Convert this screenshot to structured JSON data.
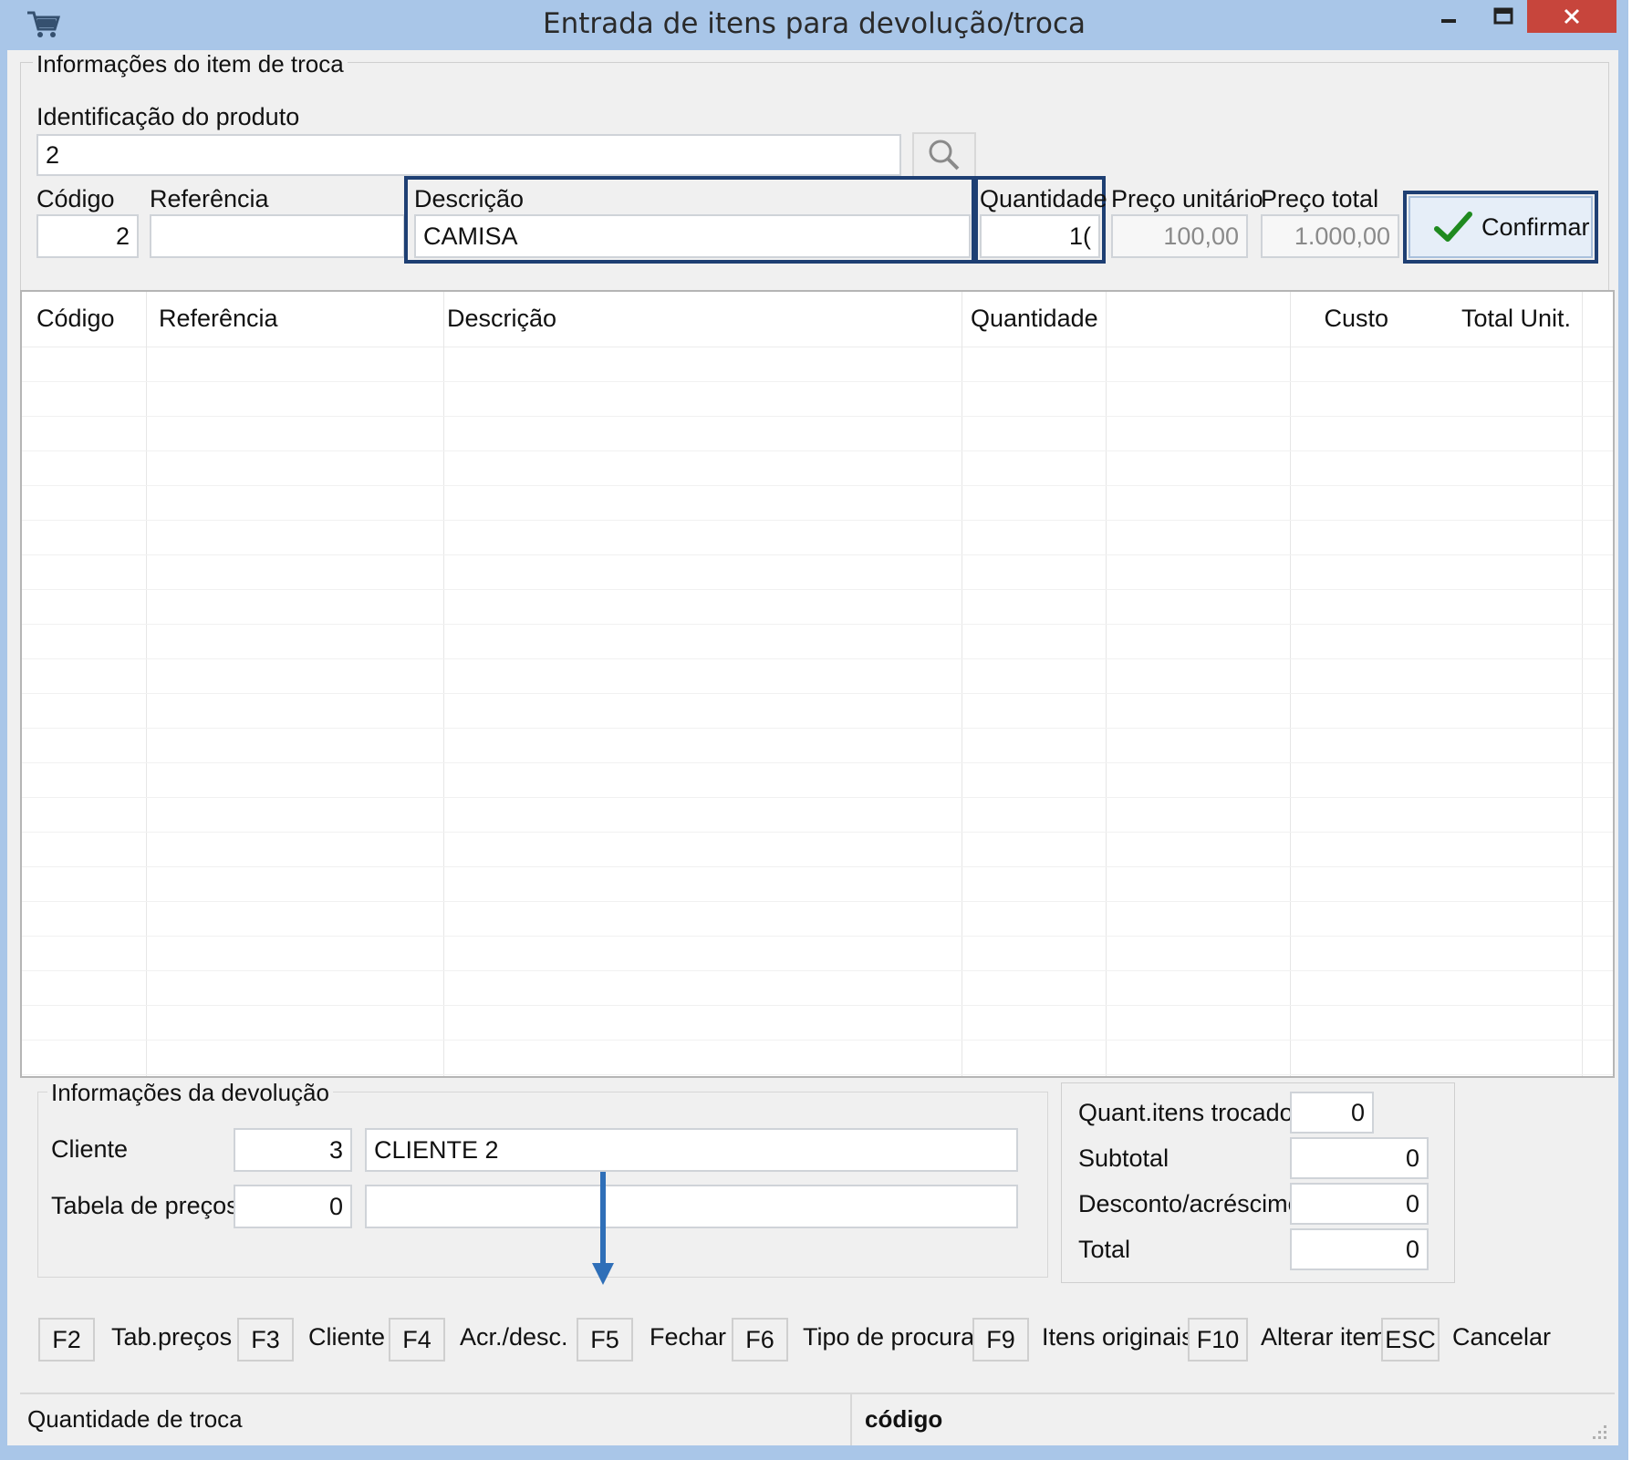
{
  "window": {
    "title": "Entrada de itens para devolução/troca",
    "icon": "cart-icon"
  },
  "item_group": {
    "title": "Informações do item de troca",
    "product_id_label": "Identificação do produto",
    "product_id_value": "2",
    "codigo_label": "Código",
    "codigo_value": "2",
    "referencia_label": "Referência",
    "referencia_value": "",
    "descricao_label": "Descrição",
    "descricao_value": "CAMISA",
    "quantidade_label": "Quantidade",
    "quantidade_value": "1(",
    "preco_unitario_label": "Preço unitário",
    "preco_unitario_value": "100,00",
    "preco_total_label": "Preço total",
    "preco_total_value": "1.000,00",
    "confirm_label": "Confirmar"
  },
  "grid": {
    "columns": [
      "Código",
      "Referência",
      "Descrição",
      "Quantidade",
      "Custo",
      "Total Unit."
    ],
    "rows": []
  },
  "devolucao_group": {
    "title": "Informações da devolução",
    "cliente_label": "Cliente",
    "cliente_code": "3",
    "cliente_name": "CLIENTE 2",
    "tabela_label": "Tabela de preços",
    "tabela_code": "0",
    "tabela_name": ""
  },
  "totals": {
    "quant_label": "Quant.itens trocados",
    "quant_value": "0",
    "subtotal_label": "Subtotal",
    "subtotal_value": "0",
    "desconto_label": "Desconto/acréscimo",
    "desconto_value": "0",
    "total_label": "Total",
    "total_value": "0"
  },
  "shortcuts": [
    {
      "key": "F2",
      "label": "Tab.preços"
    },
    {
      "key": "F3",
      "label": "Cliente"
    },
    {
      "key": "F4",
      "label": "Acr./desc."
    },
    {
      "key": "F5",
      "label": "Fechar"
    },
    {
      "key": "F6",
      "label": "Tipo de procura"
    },
    {
      "key": "F9",
      "label": "Itens originais"
    },
    {
      "key": "F10",
      "label": "Alterar item"
    },
    {
      "key": "ESC",
      "label": "Cancelar"
    }
  ],
  "status": {
    "left": "Quantidade de troca",
    "right": "código"
  },
  "colors": {
    "titlebar": "#a9c6e8",
    "focus_border": "#1e3f73",
    "close_button": "#c7453c",
    "arrow": "#2f6fb8"
  }
}
